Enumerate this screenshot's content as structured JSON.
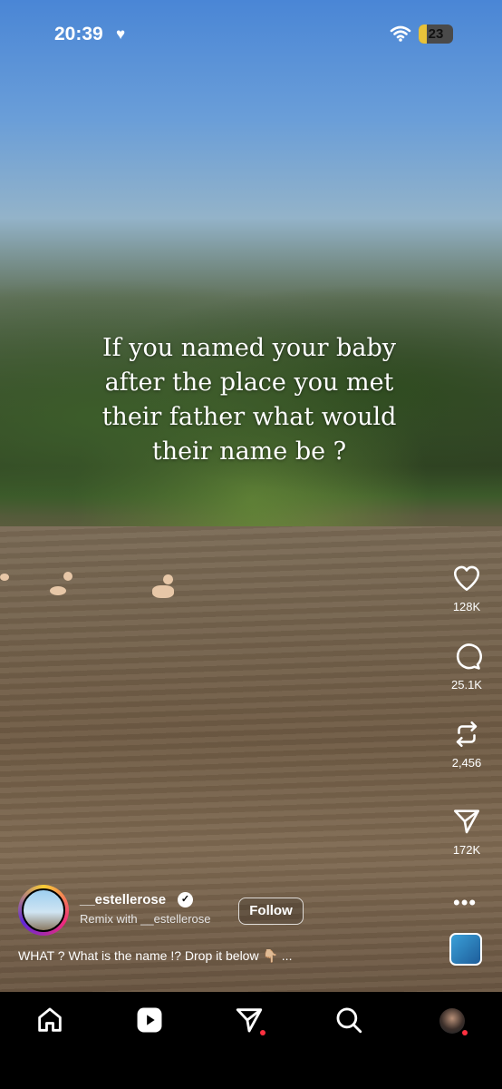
{
  "status_bar": {
    "time": "20:39",
    "battery_level": 23
  },
  "video": {
    "overlay_text": "If you named your baby after the place you met their father what would their name be ?"
  },
  "actions": {
    "like_count": "128K",
    "comment_count": "25.1K",
    "repost_count": "2,456",
    "share_count": "172K"
  },
  "author": {
    "username": "__estellerose",
    "remix_label": "Remix with __estellerose",
    "follow_label": "Follow"
  },
  "caption": "WHAT ? What is the name !? Drop it below 👇🏼 ...",
  "nav": {
    "items": [
      "home-icon",
      "reels-icon",
      "direct-messages-icon",
      "search-icon",
      "profile-avatar"
    ],
    "notification_color": "#ff3040"
  }
}
